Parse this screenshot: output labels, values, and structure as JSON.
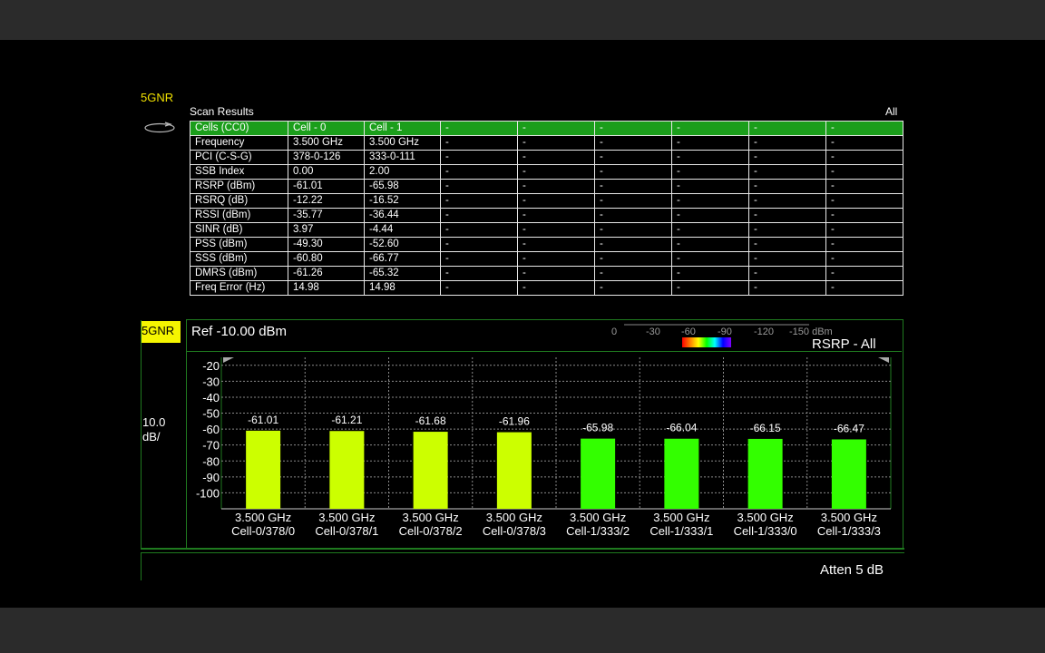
{
  "mode": "5GNR",
  "scan": {
    "title": "Scan Results",
    "filter": "All",
    "header": [
      "Cells (CC0)",
      "Cell - 0",
      "Cell - 1",
      "-",
      "-",
      "-",
      "-",
      "-",
      "-"
    ],
    "rows": [
      [
        "Frequency",
        "3.500 GHz",
        "3.500 GHz",
        "-",
        "-",
        "-",
        "-",
        "-",
        "-"
      ],
      [
        "PCI (C-S-G)",
        "378-0-126",
        "333-0-111",
        "-",
        "-",
        "-",
        "-",
        "-",
        "-"
      ],
      [
        "SSB Index",
        "0.00",
        "2.00",
        "-",
        "-",
        "-",
        "-",
        "-",
        "-"
      ],
      [
        "RSRP (dBm)",
        "-61.01",
        "-65.98",
        "-",
        "-",
        "-",
        "-",
        "-",
        "-"
      ],
      [
        "RSRQ (dB)",
        "-12.22",
        "-16.52",
        "-",
        "-",
        "-",
        "-",
        "-",
        "-"
      ],
      [
        "RSSI (dBm)",
        "-35.77",
        "-36.44",
        "-",
        "-",
        "-",
        "-",
        "-",
        "-"
      ],
      [
        "SINR (dB)",
        "3.97",
        "-4.44",
        "-",
        "-",
        "-",
        "-",
        "-",
        "-"
      ],
      [
        "PSS (dBm)",
        "-49.30",
        "-52.60",
        "-",
        "-",
        "-",
        "-",
        "-",
        "-"
      ],
      [
        "SSS (dBm)",
        "-60.80",
        "-66.77",
        "-",
        "-",
        "-",
        "-",
        "-",
        "-"
      ],
      [
        "DMRS (dBm)",
        "-61.26",
        "-65.32",
        "-",
        "-",
        "-",
        "-",
        "-",
        "-"
      ],
      [
        "Freq Error (Hz)",
        "14.98",
        "14.98",
        "-",
        "-",
        "-",
        "-",
        "-",
        "-"
      ]
    ]
  },
  "panel": {
    "badge": "5GNR",
    "ref": "Ref -10.00  dBm",
    "scale_line1": "10.0",
    "scale_line2": "dB/",
    "measure": "RSRP - All",
    "color_scale_ticks": [
      "0",
      "-30",
      "-60",
      "-90",
      "-120",
      "-150 dBm"
    ],
    "atten": "Atten 5  dB"
  },
  "colors": {
    "accent": "#1b9e1b",
    "bar_cell0": "#ccff00",
    "bar_cell1": "#33ff00",
    "badge": "#f5f500"
  },
  "chart_data": {
    "type": "bar",
    "y_ticks": [
      -20,
      -30,
      -40,
      -50,
      -60,
      -70,
      -80,
      -90,
      -100
    ],
    "ylim": [
      -110,
      -15
    ],
    "grid": true,
    "bars": [
      {
        "freq": "3.500 GHz",
        "label": "Cell-0/378/0",
        "value": -61.01,
        "group": "cell0"
      },
      {
        "freq": "3.500 GHz",
        "label": "Cell-0/378/1",
        "value": -61.21,
        "group": "cell0"
      },
      {
        "freq": "3.500 GHz",
        "label": "Cell-0/378/2",
        "value": -61.68,
        "group": "cell0"
      },
      {
        "freq": "3.500 GHz",
        "label": "Cell-0/378/3",
        "value": -61.96,
        "group": "cell0"
      },
      {
        "freq": "3.500 GHz",
        "label": "Cell-1/333/2",
        "value": -65.98,
        "group": "cell1"
      },
      {
        "freq": "3.500 GHz",
        "label": "Cell-1/333/1",
        "value": -66.04,
        "group": "cell1"
      },
      {
        "freq": "3.500 GHz",
        "label": "Cell-1/333/0",
        "value": -66.15,
        "group": "cell1"
      },
      {
        "freq": "3.500 GHz",
        "label": "Cell-1/333/3",
        "value": -66.47,
        "group": "cell1"
      }
    ]
  }
}
